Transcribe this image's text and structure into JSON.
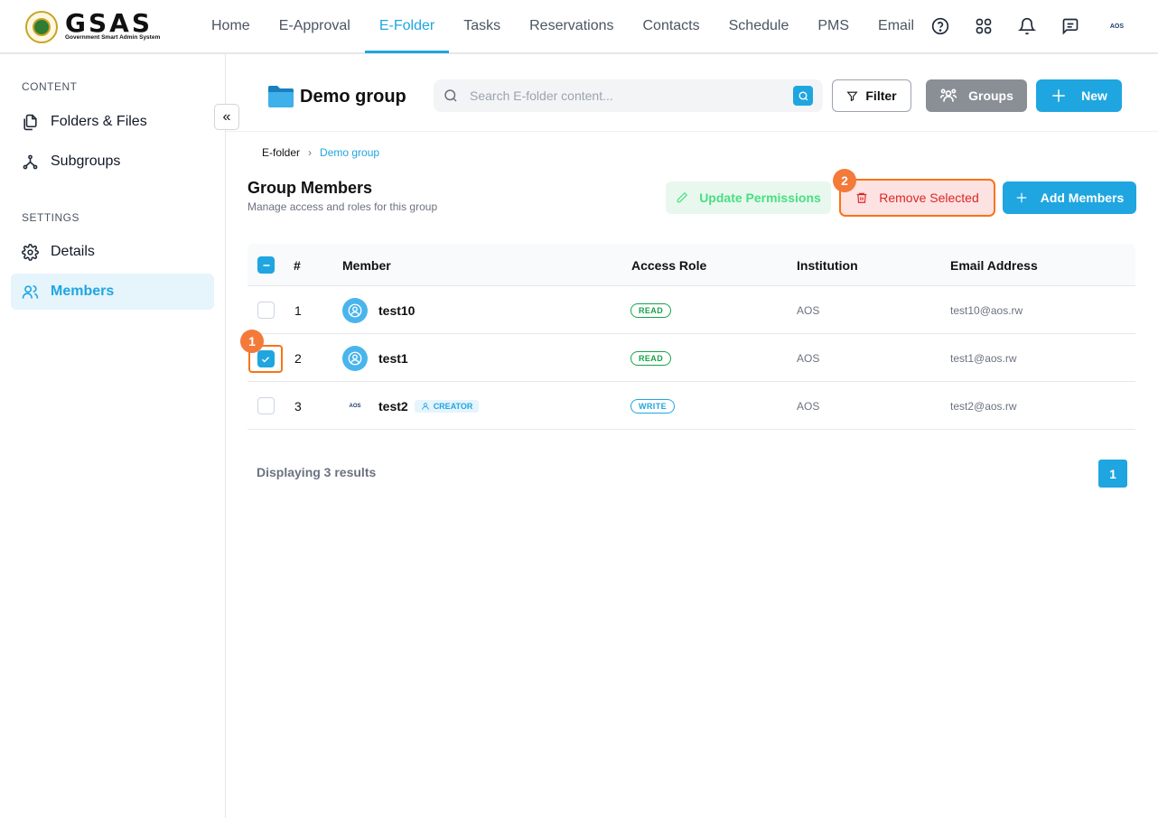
{
  "brand": {
    "title": "GSAS",
    "subtitle": "Government Smart Admin System"
  },
  "nav": {
    "items": [
      {
        "label": "Home",
        "active": false
      },
      {
        "label": "E-Approval",
        "active": false
      },
      {
        "label": "E-Folder",
        "active": true
      },
      {
        "label": "Tasks",
        "active": false
      },
      {
        "label": "Reservations",
        "active": false
      },
      {
        "label": "Contacts",
        "active": false
      },
      {
        "label": "Schedule",
        "active": false
      },
      {
        "label": "PMS",
        "active": false
      },
      {
        "label": "Email",
        "active": false
      }
    ],
    "icons": [
      "help-icon",
      "apps-grid-icon",
      "bell-icon",
      "chat-icon"
    ],
    "user_logo": "AOS"
  },
  "sidebar": {
    "content_heading": "CONTENT",
    "settings_heading": "SETTINGS",
    "items": [
      {
        "label": "Folders & Files",
        "icon": "files-icon"
      },
      {
        "label": "Subgroups",
        "icon": "subgroups-icon"
      },
      {
        "label": "Details",
        "icon": "gear-icon"
      },
      {
        "label": "Members",
        "icon": "users-icon",
        "active": true
      }
    ],
    "collapse_glyph": "«"
  },
  "header": {
    "folder_title": "Demo group",
    "search_placeholder": "Search E-folder content...",
    "filter_label": "Filter",
    "groups_label": "Groups",
    "new_label": "New"
  },
  "breadcrumb": {
    "root": "E-folder",
    "current": "Demo group"
  },
  "section": {
    "title": "Group Members",
    "subtitle": "Manage access and roles for this group",
    "update_label": "Update Permissions",
    "remove_label": "Remove Selected",
    "add_label": "Add Members"
  },
  "markers": {
    "one": "1",
    "two": "2"
  },
  "table": {
    "headers": {
      "num": "#",
      "member": "Member",
      "role": "Access Role",
      "institution": "Institution",
      "email": "Email Address"
    },
    "rows": [
      {
        "num": "1",
        "name": "test10",
        "role": "READ",
        "institution": "AOS",
        "email": "test10@aos.rw",
        "checked": false,
        "avatar": "user-avatar"
      },
      {
        "num": "2",
        "name": "test1",
        "role": "READ",
        "institution": "AOS",
        "email": "test1@aos.rw",
        "checked": true,
        "avatar": "user-avatar"
      },
      {
        "num": "3",
        "name": "test2",
        "role": "WRITE",
        "institution": "AOS",
        "email": "test2@aos.rw",
        "checked": false,
        "avatar": "AOS",
        "badge": "CREATOR"
      }
    ]
  },
  "footer": {
    "results_text": "Displaying 3 results",
    "page": "1"
  },
  "colors": {
    "accent": "#1fa6e0",
    "danger": "#dc2626",
    "success": "#4ade80",
    "marker": "#f47a3a"
  }
}
